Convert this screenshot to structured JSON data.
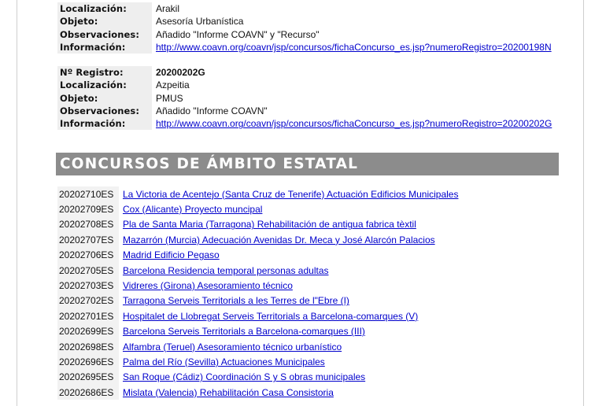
{
  "record_1": {
    "localizacion_label": "Localización:",
    "localizacion": "Arakil",
    "objeto_label": "Objeto:",
    "objeto": "Asesoría Urbanística",
    "observaciones_label": "Observaciones:",
    "observaciones": "Añadido \"Informe COAVN\" y \"Recurso\"",
    "informacion_label": "Información:",
    "informacion": "http://www.coavn.org/coavn/jsp/concursos/fichaConcurso_es.jsp?numeroRegistro=20200198N"
  },
  "record_2": {
    "registro_label": "Nº Registro:",
    "registro": "20200202G",
    "localizacion_label": "Localización:",
    "localizacion": "Azpeitia",
    "objeto_label": "Objeto:",
    "objeto": "PMUS",
    "observaciones_label": "Observaciones:",
    "observaciones": "Añadido \"Informe COAVN\"",
    "informacion_label": "Información:",
    "informacion": "http://www.coavn.org/coavn/jsp/concursos/fichaConcurso_es.jsp?numeroRegistro=20200202G"
  },
  "section_title": "CONCURSOS DE ÁMBITO ESTATAL",
  "entries": [
    {
      "code": "20202710ES",
      "title": "La Victoria de Acentejo (Santa Cruz de Tenerife) Actuación Edificios Municipales"
    },
    {
      "code": "20202709ES",
      "title": "Cox (Alicante) Proyecto muncipal"
    },
    {
      "code": "20202708ES",
      "title": "Pla de Santa Maria (Tarragona) Rehabilitación de antigua fabrica tèxtil"
    },
    {
      "code": "20202707ES",
      "title": "Mazarrón (Murcia) Adecuación Avenidas Dr. Meca y José Alarcón Palacios"
    },
    {
      "code": "20202706ES",
      "title": "Madrid Edificio Pegaso"
    },
    {
      "code": "20202705ES",
      "title": "Barcelona Residencia temporal personas adultas"
    },
    {
      "code": "20202703ES",
      "title": "Vidreres (Girona) Asesoramiento técnico"
    },
    {
      "code": "20202702ES",
      "title": "Tarragona Serveis Territorials a les Terres de l\"Ebre (I)"
    },
    {
      "code": "20202701ES",
      "title": "Hospitalet de Llobregat Serveis Territorials a Barcelona-comarques (V)"
    },
    {
      "code": "20202699ES",
      "title": "Barcelona Serveis Territorials a Barcelona-comarques (III)"
    },
    {
      "code": "20202698ES",
      "title": "Alfambra (Teruel) Asesoramiento técnico urbanístico"
    },
    {
      "code": "20202696ES",
      "title": "Palma del Río (Sevilla) Actuaciones Municipales"
    },
    {
      "code": "20202695ES",
      "title": "San Roque (Cádiz) Coordinación S y S obras municipales"
    },
    {
      "code": "20202686ES",
      "title": "Mislata (Valencia) Rehabilitación Casa Consistoria"
    }
  ]
}
